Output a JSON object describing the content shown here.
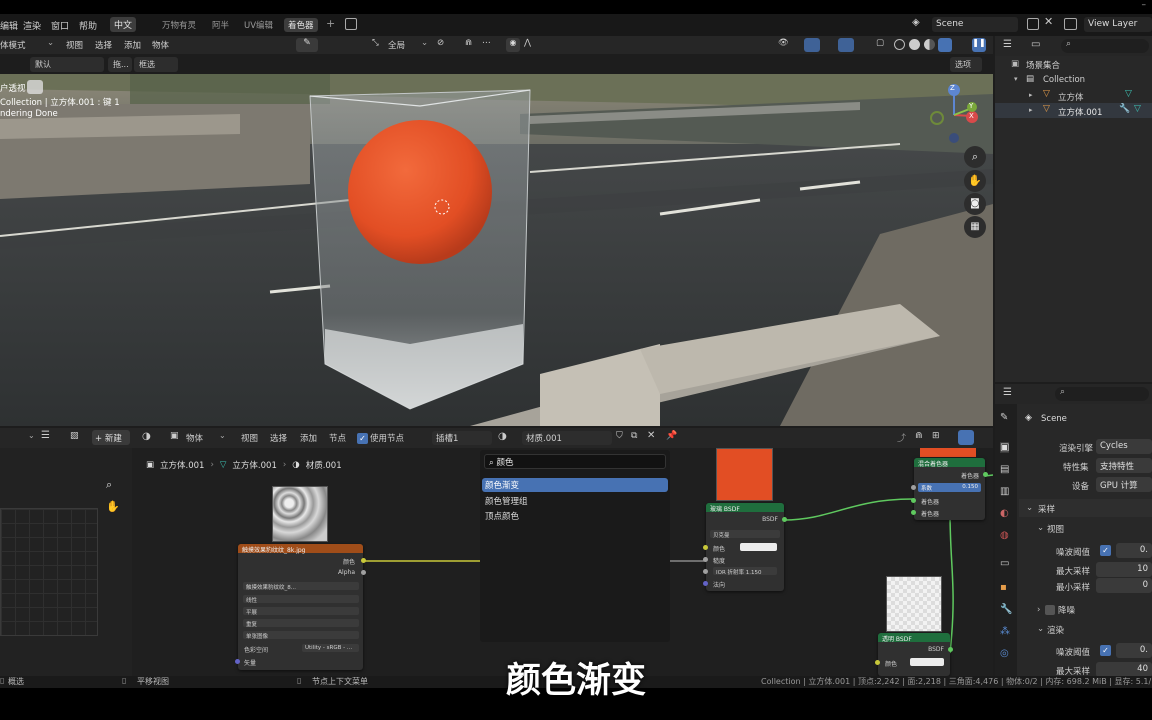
{
  "top_menu": {
    "items": [
      "编辑",
      "渲染",
      "窗口",
      "帮助"
    ],
    "lang": "中文",
    "workspaces": [
      "万物有灵",
      "阿半",
      "UV编辑",
      "着色器"
    ],
    "active_workspace": "着色器",
    "add_tab": "+",
    "scene_name": "Scene",
    "view_layer": "View Layer"
  },
  "viewport_header": {
    "mode": "体模式",
    "menus": [
      "视图",
      "选择",
      "添加",
      "物体"
    ],
    "transform_space": "全局",
    "options": "选项"
  },
  "viewport_header2": {
    "default": "默认",
    "drag": "拖...",
    "select_box": "框选"
  },
  "viewport_overlay": {
    "view_name": "户透视",
    "collection_line": "Collection | 立方体.001 : 键 1",
    "render_status": "ndering Done",
    "gizmo_x": "X",
    "gizmo_y": "Y",
    "gizmo_z": "Z"
  },
  "outliner": {
    "root": "场景集合",
    "collection": "Collection",
    "objects": [
      "立方体",
      "立方体.001"
    ]
  },
  "properties": {
    "scene": "Scene",
    "render_engine_label": "渲染引擎",
    "render_engine": "Cycles",
    "feature_set_label": "特性集",
    "feature_set": "支持特性",
    "device_label": "设备",
    "device": "GPU 计算",
    "sampling": "采样",
    "viewport": "视图",
    "noise_threshold_label": "噪波阈值",
    "noise_threshold_val": "0.",
    "max_samples_label": "最大采样",
    "max_samples_val": "10",
    "min_samples_label": "最小采样",
    "min_samples_val": "0",
    "denoise": "降噪",
    "render": "渲染",
    "render_noise_label": "噪波阈值",
    "render_noise_val": "0.",
    "render_max_label": "最大采样",
    "render_max_val": "40"
  },
  "node_editor_header": {
    "new_button": "新建",
    "object_mode": "物体",
    "menus": [
      "视图",
      "选择",
      "添加",
      "节点"
    ],
    "use_nodes": "使用节点",
    "slot": "插槽1",
    "material": "材质.001"
  },
  "breadcrumb": [
    "立方体.001",
    "立方体.001",
    "材质.001"
  ],
  "search_popup": {
    "query": "颜色",
    "results": [
      "颜色渐变",
      "颜色管理组",
      "顶点颜色"
    ]
  },
  "image_node": {
    "title": "触摸效果豹纹纹_8k.jpg",
    "out_color": "颜色",
    "out_alpha": "Alpha",
    "file": "触摸效果豹纹纹_8...",
    "interp": "线性",
    "proj": "平展",
    "ext": "重复",
    "source": "单张图像",
    "colorspace_label": "色彩空间",
    "colorspace": "Utility - sRGB - ...",
    "vector": "矢量"
  },
  "glass_node": {
    "title": "玻璃 BSDF",
    "output": "BSDF",
    "dist": "贝克曼",
    "color": "颜色",
    "roughness": "糙度",
    "ior": "IOR 折射率",
    "ior_val": "1.150",
    "normal": "法向"
  },
  "mix_node": {
    "title": "混合着色器",
    "output": "着色器",
    "fac": "系数",
    "fac_val": "0.150",
    "shader1": "着色器",
    "shader2": "着色器"
  },
  "trans_node": {
    "title": "透明 BSDF",
    "output": "BSDF",
    "color": "颜色"
  },
  "status_bar": {
    "left": "概选",
    "mid1": "平移视图",
    "mid2": "节点上下文菜单",
    "right": "Collection | 立方体.001 | 顶点:2,242 | 面:2,218 | 三角面:4,476 | 物体:0/2 | 内存: 698.2 MiB | 显存: 5.1/"
  },
  "subtitle": "颜色渐变",
  "colors": {
    "accent": "#4772b3",
    "glass_header": "#1f6e3d",
    "image_header": "#a04d19",
    "link_green": "#5fc95f",
    "link_yellow": "#c8c83a",
    "ball": "#e24e24"
  }
}
